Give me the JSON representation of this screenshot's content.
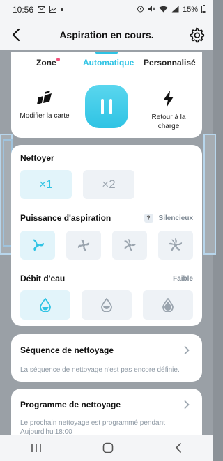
{
  "status_bar": {
    "time": "10:56",
    "battery": "15%"
  },
  "header": {
    "title": "Aspiration en cours."
  },
  "mode_tabs": [
    {
      "label": "Zone"
    },
    {
      "label": "Automatique"
    },
    {
      "label": "Personnalisé"
    }
  ],
  "actions": {
    "edit_map": "Modifier la carte",
    "return_to_dock": "Retour à la charge"
  },
  "clean": {
    "heading": "Nettoyer",
    "options": [
      "×1",
      "×2"
    ]
  },
  "suction": {
    "heading": "Puissance d'aspiration",
    "help": "?",
    "value": "Silencieux"
  },
  "water": {
    "heading": "Débit d'eau",
    "value": "Faible"
  },
  "sequence": {
    "title": "Séquence de nettoyage",
    "subtitle": "La séquence de nettoyage n'est pas encore définie."
  },
  "schedule": {
    "title": "Programme de nettoyage",
    "subtitle": "Le prochain nettoyage est programmé pendant Aujourd'hui18:00"
  },
  "colors": {
    "accent": "#2ec3e4",
    "muted": "#9aa4ae",
    "dot": "#f0507a"
  }
}
